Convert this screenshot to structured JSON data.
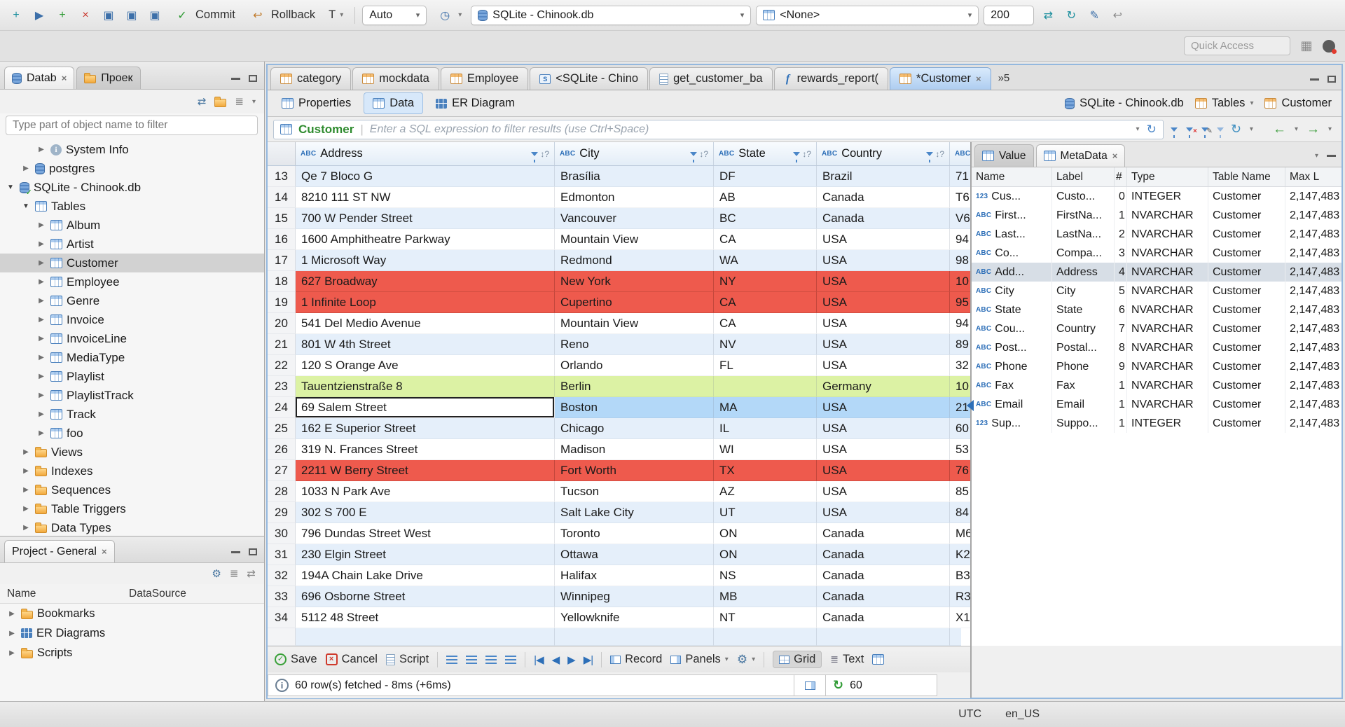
{
  "icons": {
    "close": "×",
    "caret": "▾",
    "refresh": "↻",
    "gear": "⚙",
    "check": "✓",
    "sort": "↕?",
    "prev": "◀",
    "next": "▶",
    "first": "|◀",
    "last": "▶|",
    "left": "←",
    "right": "→",
    "undo": "↩",
    "sync": "⇄",
    "clock": "◷",
    "pencil": "✎",
    "menu_grid": "▦",
    "lines": "≣",
    "info": "i",
    "txn": "T"
  },
  "toolbar": {
    "commit": "Commit",
    "rollback": "Rollback",
    "auto": "Auto",
    "db_combo": "SQLite - Chinook.db",
    "schema_combo": "<None>",
    "fetch_size": "200",
    "quick_access": "Quick Access"
  },
  "sidebar": {
    "tab_db": "Datab",
    "tab_proj": "Проек",
    "filter_placeholder": "Type part of object name to filter",
    "tree": [
      {
        "label": "System Info",
        "indent": 2,
        "arrow": "r",
        "icon": "info"
      },
      {
        "label": "postgres",
        "indent": 1,
        "arrow": "r",
        "icon": "db"
      },
      {
        "label": "SQLite - Chinook.db",
        "indent": 0,
        "arrow": "d",
        "icon": "db-check"
      },
      {
        "label": "Tables",
        "indent": 1,
        "arrow": "d",
        "icon": "table"
      },
      {
        "label": "Album",
        "indent": 2,
        "arrow": "r",
        "icon": "table"
      },
      {
        "label": "Artist",
        "indent": 2,
        "arrow": "r",
        "icon": "table"
      },
      {
        "label": "Customer",
        "indent": 2,
        "arrow": "r",
        "icon": "table",
        "selected": true
      },
      {
        "label": "Employee",
        "indent": 2,
        "arrow": "r",
        "icon": "table"
      },
      {
        "label": "Genre",
        "indent": 2,
        "arrow": "r",
        "icon": "table"
      },
      {
        "label": "Invoice",
        "indent": 2,
        "arrow": "r",
        "icon": "table"
      },
      {
        "label": "InvoiceLine",
        "indent": 2,
        "arrow": "r",
        "icon": "table"
      },
      {
        "label": "MediaType",
        "indent": 2,
        "arrow": "r",
        "icon": "table"
      },
      {
        "label": "Playlist",
        "indent": 2,
        "arrow": "r",
        "icon": "table"
      },
      {
        "label": "PlaylistTrack",
        "indent": 2,
        "arrow": "r",
        "icon": "table"
      },
      {
        "label": "Track",
        "indent": 2,
        "arrow": "r",
        "icon": "table"
      },
      {
        "label": "foo",
        "indent": 2,
        "arrow": "r",
        "icon": "table"
      },
      {
        "label": "Views",
        "indent": 1,
        "arrow": "r",
        "icon": "folder"
      },
      {
        "label": "Indexes",
        "indent": 1,
        "arrow": "r",
        "icon": "folder"
      },
      {
        "label": "Sequences",
        "indent": 1,
        "arrow": "r",
        "icon": "folder"
      },
      {
        "label": "Table Triggers",
        "indent": 1,
        "arrow": "r",
        "icon": "folder"
      },
      {
        "label": "Data Types",
        "indent": 1,
        "arrow": "r",
        "icon": "folder"
      }
    ]
  },
  "project_panel": {
    "title": "Project - General",
    "col_name": "Name",
    "col_datasource": "DataSource",
    "items": [
      {
        "label": "Bookmarks",
        "icon": "folder"
      },
      {
        "label": "ER Diagrams",
        "icon": "er"
      },
      {
        "label": "Scripts",
        "icon": "folder"
      }
    ]
  },
  "editor": {
    "tabs": [
      {
        "label": "category",
        "icon": "table"
      },
      {
        "label": "mockdata",
        "icon": "table"
      },
      {
        "label": "Employee",
        "icon": "table"
      },
      {
        "label": "<SQLite - Chino",
        "icon": "sql"
      },
      {
        "label": "get_customer_ba",
        "icon": "script"
      },
      {
        "label": "rewards_report(",
        "icon": "function"
      },
      {
        "label": "*Customer",
        "icon": "table",
        "active": true
      }
    ],
    "overflow": "»5"
  },
  "result_tabs": {
    "properties": "Properties",
    "data": "Data",
    "er": "ER Diagram",
    "db": "SQLite - Chinook.db",
    "tables": "Tables",
    "table": "Customer"
  },
  "filter": {
    "table": "Customer",
    "placeholder": "Enter a SQL expression to filter results (use Ctrl+Space)"
  },
  "grid": {
    "type_badge": "ABC",
    "columns": [
      "Address",
      "City",
      "State",
      "Country"
    ],
    "rows": [
      {
        "num": "13",
        "address": "Qe 7 Bloco G",
        "city": "Brasília",
        "state": "DF",
        "country": "Brazil",
        "postal": "71"
      },
      {
        "num": "14",
        "address": "8210 111 ST NW",
        "city": "Edmonton",
        "state": "AB",
        "country": "Canada",
        "postal": "T6"
      },
      {
        "num": "15",
        "address": "700 W Pender Street",
        "city": "Vancouver",
        "state": "BC",
        "country": "Canada",
        "postal": "V6"
      },
      {
        "num": "16",
        "address": "1600 Amphitheatre Parkway",
        "city": "Mountain View",
        "state": "CA",
        "country": "USA",
        "postal": "94"
      },
      {
        "num": "17",
        "address": "1 Microsoft Way",
        "city": "Redmond",
        "state": "WA",
        "country": "USA",
        "postal": "98"
      },
      {
        "num": "18",
        "address": "627 Broadway",
        "city": "New York",
        "state": "NY",
        "country": "USA",
        "postal": "10",
        "hl": "red"
      },
      {
        "num": "19",
        "address": "1 Infinite Loop",
        "city": "Cupertino",
        "state": "CA",
        "country": "USA",
        "postal": "95",
        "hl": "red"
      },
      {
        "num": "20",
        "address": "541 Del Medio Avenue",
        "city": "Mountain View",
        "state": "CA",
        "country": "USA",
        "postal": "94"
      },
      {
        "num": "21",
        "address": "801 W 4th Street",
        "city": "Reno",
        "state": "NV",
        "country": "USA",
        "postal": "89"
      },
      {
        "num": "22",
        "address": "120 S Orange Ave",
        "city": "Orlando",
        "state": "FL",
        "country": "USA",
        "postal": "32"
      },
      {
        "num": "23",
        "address": "Tauentzienstraße 8",
        "city": "Berlin",
        "state": "",
        "country": "Germany",
        "postal": "10",
        "hl": "green"
      },
      {
        "num": "24",
        "address": "69 Salem Street",
        "city": "Boston",
        "state": "MA",
        "country": "USA",
        "postal": "21",
        "hl": "selected"
      },
      {
        "num": "25",
        "address": "162 E Superior Street",
        "city": "Chicago",
        "state": "IL",
        "country": "USA",
        "postal": "60"
      },
      {
        "num": "26",
        "address": "319 N. Frances Street",
        "city": "Madison",
        "state": "WI",
        "country": "USA",
        "postal": "53"
      },
      {
        "num": "27",
        "address": "2211 W Berry Street",
        "city": "Fort Worth",
        "state": "TX",
        "country": "USA",
        "postal": "76",
        "hl": "red"
      },
      {
        "num": "28",
        "address": "1033 N Park Ave",
        "city": "Tucson",
        "state": "AZ",
        "country": "USA",
        "postal": "85"
      },
      {
        "num": "29",
        "address": "302 S 700 E",
        "city": "Salt Lake City",
        "state": "UT",
        "country": "USA",
        "postal": "84"
      },
      {
        "num": "30",
        "address": "796 Dundas Street West",
        "city": "Toronto",
        "state": "ON",
        "country": "Canada",
        "postal": "M6"
      },
      {
        "num": "31",
        "address": "230 Elgin Street",
        "city": "Ottawa",
        "state": "ON",
        "country": "Canada",
        "postal": "K2"
      },
      {
        "num": "32",
        "address": "194A Chain Lake Drive",
        "city": "Halifax",
        "state": "NS",
        "country": "Canada",
        "postal": "B3"
      },
      {
        "num": "33",
        "address": "696 Osborne Street",
        "city": "Winnipeg",
        "state": "MB",
        "country": "Canada",
        "postal": "R3"
      },
      {
        "num": "34",
        "address": "5112 48 Street",
        "city": "Yellowknife",
        "state": "NT",
        "country": "Canada",
        "postal": "X1"
      }
    ]
  },
  "metadata": {
    "tab_value": "Value",
    "tab_metadata": "MetaData",
    "columns": [
      "Name",
      "Label",
      "#",
      "Type",
      "Table Name",
      "Max L"
    ],
    "rows": [
      {
        "icon": "123",
        "name": "Cus...",
        "label": "Custo...",
        "num": "0",
        "type": "INTEGER",
        "table": "Customer",
        "max": "2,147,483"
      },
      {
        "icon": "ABC",
        "name": "First...",
        "label": "FirstNa...",
        "num": "1",
        "type": "NVARCHAR",
        "table": "Customer",
        "max": "2,147,483"
      },
      {
        "icon": "ABC",
        "name": "Last...",
        "label": "LastNa...",
        "num": "2",
        "type": "NVARCHAR",
        "table": "Customer",
        "max": "2,147,483"
      },
      {
        "icon": "ABC",
        "name": "Co...",
        "label": "Compa...",
        "num": "3",
        "type": "NVARCHAR",
        "table": "Customer",
        "max": "2,147,483"
      },
      {
        "icon": "ABC",
        "name": "Add...",
        "label": "Address",
        "num": "4",
        "type": "NVARCHAR",
        "table": "Customer",
        "max": "2,147,483",
        "sel": true
      },
      {
        "icon": "ABC",
        "name": "City",
        "label": "City",
        "num": "5",
        "type": "NVARCHAR",
        "table": "Customer",
        "max": "2,147,483"
      },
      {
        "icon": "ABC",
        "name": "State",
        "label": "State",
        "num": "6",
        "type": "NVARCHAR",
        "table": "Customer",
        "max": "2,147,483"
      },
      {
        "icon": "ABC",
        "name": "Cou...",
        "label": "Country",
        "num": "7",
        "type": "NVARCHAR",
        "table": "Customer",
        "max": "2,147,483"
      },
      {
        "icon": "ABC",
        "name": "Post...",
        "label": "Postal...",
        "num": "8",
        "type": "NVARCHAR",
        "table": "Customer",
        "max": "2,147,483"
      },
      {
        "icon": "ABC",
        "name": "Phone",
        "label": "Phone",
        "num": "9",
        "type": "NVARCHAR",
        "table": "Customer",
        "max": "2,147,483"
      },
      {
        "icon": "ABC",
        "name": "Fax",
        "label": "Fax",
        "num": "1",
        "type": "NVARCHAR",
        "table": "Customer",
        "max": "2,147,483"
      },
      {
        "icon": "ABC",
        "name": "Email",
        "label": "Email",
        "num": "1",
        "type": "NVARCHAR",
        "table": "Customer",
        "max": "2,147,483"
      },
      {
        "icon": "123",
        "name": "Sup...",
        "label": "Suppo...",
        "num": "1",
        "type": "INTEGER",
        "table": "Customer",
        "max": "2,147,483"
      }
    ]
  },
  "footer": {
    "save": "Save",
    "cancel": "Cancel",
    "script": "Script",
    "record": "Record",
    "panels": "Panels",
    "grid": "Grid",
    "text": "Text"
  },
  "status": {
    "fetched": "60 row(s) fetched - 8ms (+6ms)",
    "count": "60"
  },
  "appbar": {
    "tz": "UTC",
    "locale": "en_US"
  }
}
